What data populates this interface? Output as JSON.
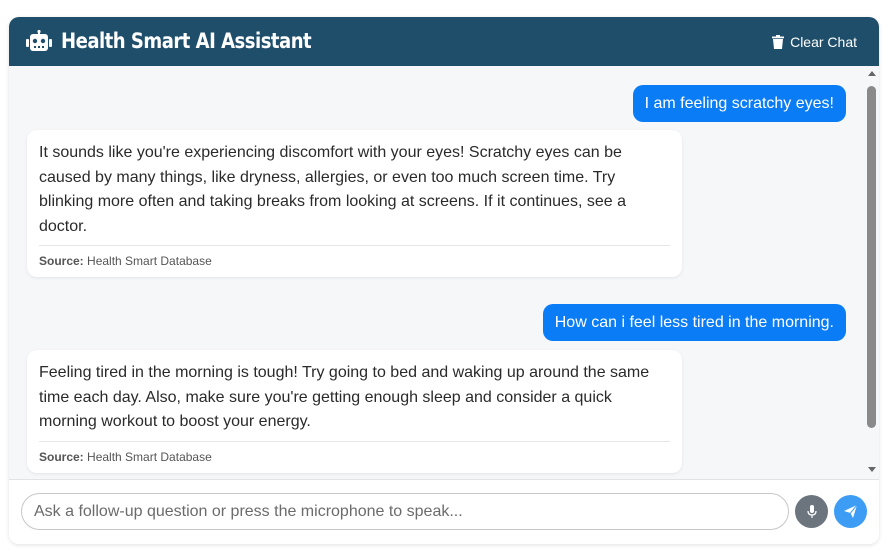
{
  "header": {
    "title": "Health Smart AI Assistant",
    "clear_label": "Clear Chat",
    "icon": "robot-icon",
    "background": "#1f4e6b"
  },
  "messages": [
    {
      "role": "user",
      "text": "I am feeling scratchy eyes!"
    },
    {
      "role": "bot",
      "text": "It sounds like you're experiencing discomfort with your eyes! Scratchy eyes can be caused by many things, like dryness, allergies, or even too much screen time. Try blinking more often and taking breaks from looking at screens. If it continues, see a doctor.",
      "source_label": "Source:",
      "source": "Health Smart Database"
    },
    {
      "role": "user",
      "text": "How can i feel less tired in the morning."
    },
    {
      "role": "bot",
      "text": "Feeling tired in the morning is tough! Try going to bed and waking up around the same time each day. Also, make sure you're getting enough sleep and consider a quick morning workout to boost your energy.",
      "source_label": "Source:",
      "source": "Health Smart Database"
    }
  ],
  "input": {
    "placeholder": "Ask a follow-up question or press the microphone to speak...",
    "value": ""
  },
  "buttons": {
    "mic_icon": "microphone-icon",
    "send_icon": "send-icon"
  },
  "colors": {
    "user_bubble": "#0a7cf5",
    "send_button": "#3d9df5",
    "mic_button": "#6c757d"
  }
}
